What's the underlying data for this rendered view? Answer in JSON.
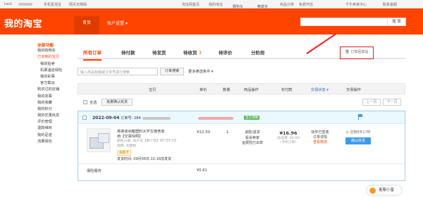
{
  "topbar": {
    "user": "tao1",
    "mobile": "手机逛淘宝",
    "accessible": "网页无障碍",
    "home": "淘宝网首页",
    "my": "我的淘宝",
    "cart": "购物车",
    "fav": "收藏夹",
    "category": "商品分类",
    "free_open": "免费开店",
    "seller": "千牛卖家中心",
    "contact": "联系客服"
  },
  "header": {
    "logo": "我的淘宝",
    "nav_home": "首页",
    "nav_account": "账户设置",
    "search_button": "搜 索"
  },
  "sidebar": {
    "title": "全部功能",
    "items": [
      "我的购物车",
      "已买到的宝贝",
      "我的拍卖",
      "机票酒店保险",
      "我的彩票",
      "官方集运",
      "购买过的店铺",
      "我的发票",
      "我的收藏",
      "我的积分",
      "我的优惠信息",
      "评价管理",
      "退款维权",
      "我的足迹",
      "流量钱包"
    ]
  },
  "tabs": [
    {
      "label": "所有订单",
      "count": ""
    },
    {
      "label": "待付款",
      "count": ""
    },
    {
      "label": "待发货",
      "count": ""
    },
    {
      "label": "待收货",
      "count": "3"
    },
    {
      "label": "待评价",
      "count": ""
    },
    {
      "label": "分阶段",
      "count": ""
    }
  ],
  "recycle_label": "订单回收站",
  "search": {
    "placeholder": "输入商品标题或订单号进行搜索",
    "button": "订单搜索",
    "more": "更多筛选条件"
  },
  "table_head": {
    "item": "宝贝",
    "price": "单价",
    "qty": "数量",
    "ops": "商品操作",
    "real": "实付款",
    "status": "交易状态",
    "trade_ops": "交易操作"
  },
  "subrow": {
    "select_all": "全选",
    "batch_confirm": "批量确认收货",
    "prev": "上一页",
    "next": "下一页"
  },
  "order": {
    "date": "2022-09-04",
    "order_no_label": "订单号: 284",
    "tag": "官方保障",
    "title": "亮亮收纳箱塑料大学生宿舍家用【交易快照】",
    "attr1": "颜色分类: 加大号【单个装】45*33*29",
    "attr2": "规格: 北欧粉",
    "insure": "保障卡",
    "ship_time": "发货时间: 09月06日 22:16前发货",
    "price": "¥22.50",
    "qty": "1",
    "ops": [
      "退款/退货",
      "投诉卖家",
      "运费险已出单"
    ],
    "real_amount": "¥16.96",
    "freight": "(含运费: ¥0.00)",
    "pay": "(手机订单)",
    "status": [
      "快件已签收",
      "订单详情",
      "查看物流"
    ],
    "countdown": "还剩8天17时",
    "confirm_button": "确认收货",
    "service": "保险服务",
    "service_price": "¥0.61"
  },
  "cs_float": "客服小蜜"
}
